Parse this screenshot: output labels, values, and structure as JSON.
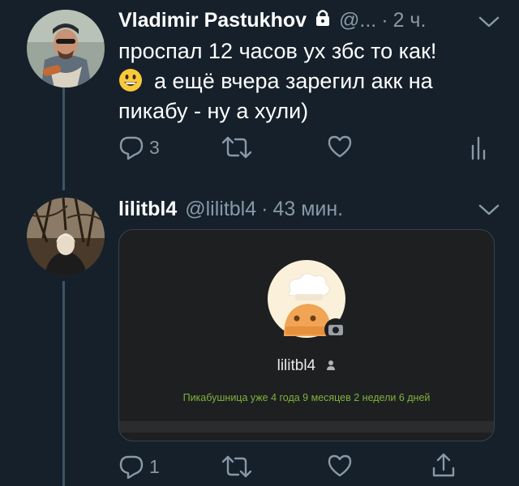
{
  "tweet1": {
    "name": "Vladimir Pastukhov",
    "handle": "@...",
    "dot": "·",
    "time": "2 ч.",
    "line1": "проспал 12 часов ух збс то как!",
    "line2": "а ещё вчера зарегил акк на",
    "line3": "пикабу - ну а хули)",
    "reply_count": "3"
  },
  "tweet2": {
    "name": "lilitbl4",
    "handle": "@lilitbl4",
    "dot": "·",
    "time": "43 мин.",
    "reply_count": "1",
    "card": {
      "username": "lilitbl4",
      "tenure": "Пикабушница уже 4 года 9 месяцев 2 недели 6 дней"
    }
  },
  "colors": {
    "background": "#15202b",
    "secondary_text": "#8899a6",
    "card_background": "#1d1f21",
    "tenure_green": "#7fb33a"
  }
}
